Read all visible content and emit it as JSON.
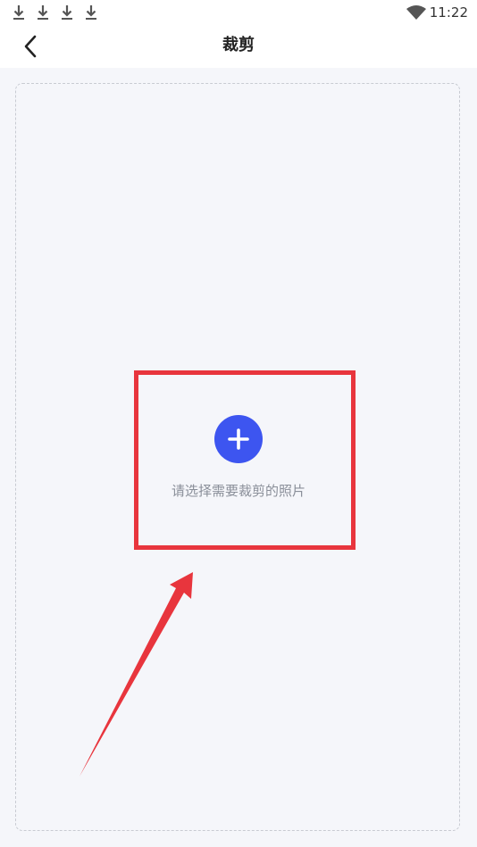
{
  "status_bar": {
    "time": "11:22",
    "icons": [
      "download-icon",
      "download-icon",
      "download-icon",
      "download-icon",
      "wifi-icon"
    ]
  },
  "header": {
    "title": "裁剪",
    "back_icon": "chevron-left-icon"
  },
  "upload": {
    "add_icon": "plus-icon",
    "hint": "请选择需要裁剪的照片",
    "accent_color": "#3d55f0"
  },
  "annotation": {
    "highlight_color": "#e8353d"
  }
}
